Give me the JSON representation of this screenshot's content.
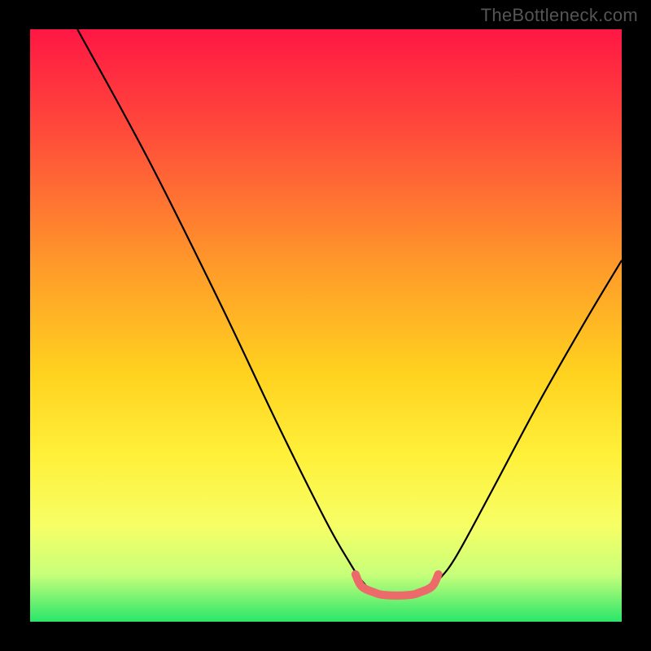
{
  "watermark": "TheBottleneck.com",
  "chart_data": {
    "type": "line",
    "title": "",
    "xlabel": "",
    "ylabel": "",
    "xlim": [
      0,
      100
    ],
    "ylim": [
      0,
      100
    ],
    "gradient_stops": [
      {
        "offset": 0,
        "color": "#ff1744"
      },
      {
        "offset": 18,
        "color": "#ff4d3a"
      },
      {
        "offset": 40,
        "color": "#ff9a2a"
      },
      {
        "offset": 58,
        "color": "#ffd21f"
      },
      {
        "offset": 72,
        "color": "#fff03a"
      },
      {
        "offset": 84,
        "color": "#f6ff66"
      },
      {
        "offset": 92,
        "color": "#c8ff7a"
      },
      {
        "offset": 100,
        "color": "#29e66a"
      }
    ],
    "series": [
      {
        "name": "bottleneck-curve",
        "stroke": "#000000",
        "values": [
          {
            "x": 8,
            "y": 100
          },
          {
            "x": 20,
            "y": 78
          },
          {
            "x": 32,
            "y": 54
          },
          {
            "x": 42,
            "y": 33
          },
          {
            "x": 50,
            "y": 17
          },
          {
            "x": 54,
            "y": 10
          },
          {
            "x": 56,
            "y": 7
          },
          {
            "x": 58,
            "y": 5
          },
          {
            "x": 60,
            "y": 4.5
          },
          {
            "x": 64,
            "y": 4.5
          },
          {
            "x": 67,
            "y": 5
          },
          {
            "x": 69,
            "y": 7
          },
          {
            "x": 72,
            "y": 11
          },
          {
            "x": 78,
            "y": 22
          },
          {
            "x": 86,
            "y": 37
          },
          {
            "x": 94,
            "y": 51
          },
          {
            "x": 100,
            "y": 61
          }
        ]
      },
      {
        "name": "optimal-range-marker",
        "stroke": "#ec6a6a",
        "values": [
          {
            "x": 55,
            "y": 8
          },
          {
            "x": 56,
            "y": 6
          },
          {
            "x": 58,
            "y": 5
          },
          {
            "x": 60,
            "y": 4.5
          },
          {
            "x": 64,
            "y": 4.5
          },
          {
            "x": 66,
            "y": 5
          },
          {
            "x": 68,
            "y": 6
          },
          {
            "x": 69,
            "y": 8
          }
        ]
      }
    ]
  }
}
